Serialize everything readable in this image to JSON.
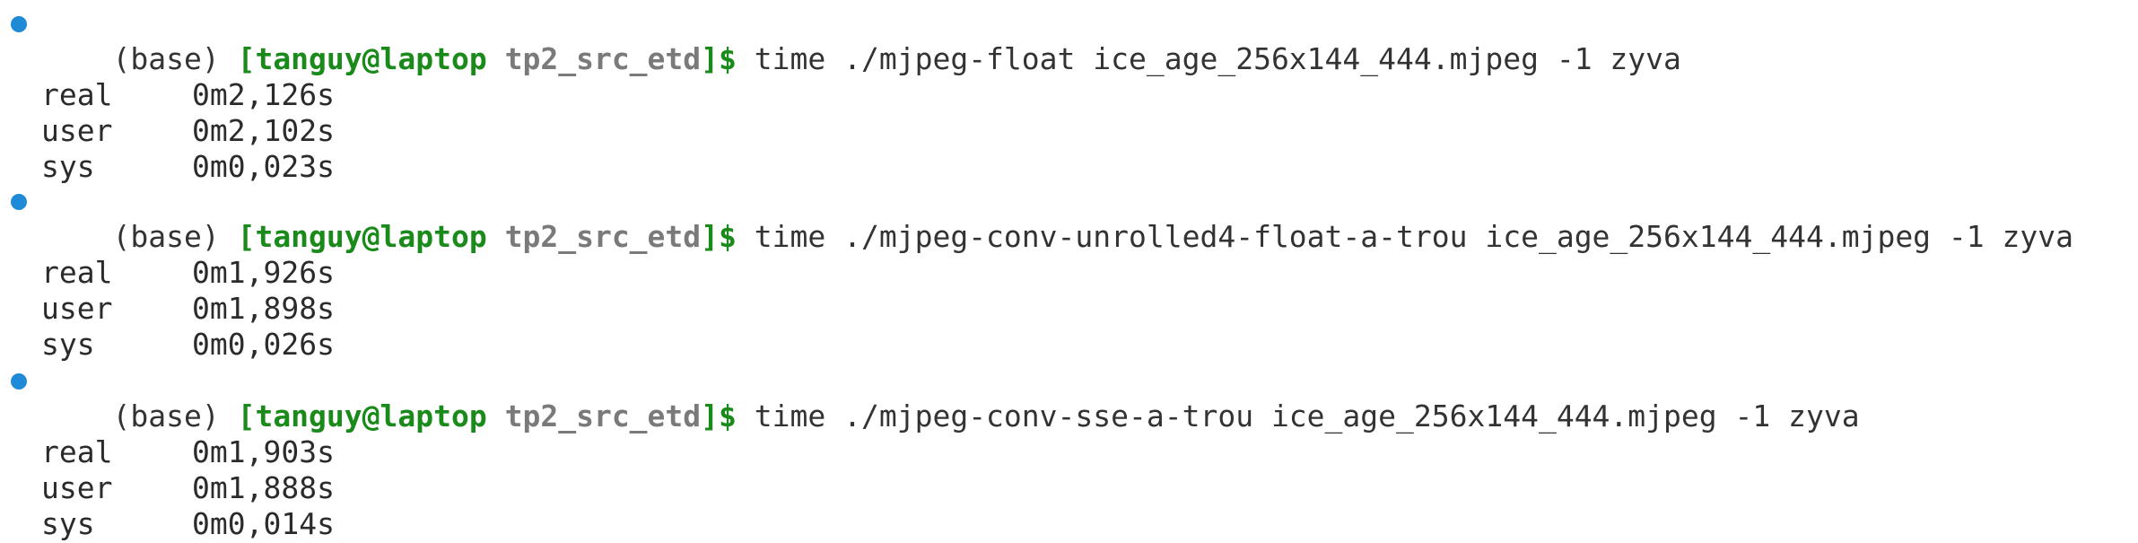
{
  "terminal": {
    "blocks": [
      {
        "env": "(base)",
        "user_host": "[tanguy@laptop",
        "cwd": "tp2_src_etd",
        "prompt_end": "]$",
        "command": "time ./mjpeg-float ice_age_256x144_444.mjpeg -1 zyva",
        "real_label": "real",
        "real_value": "0m2,126s",
        "user_label": "user",
        "user_value": "0m2,102s",
        "sys_label": "sys",
        "sys_value": "0m0,023s"
      },
      {
        "env": "(base)",
        "user_host": "[tanguy@laptop",
        "cwd": "tp2_src_etd",
        "prompt_end": "]$",
        "command": "time ./mjpeg-conv-unrolled4-float-a-trou ice_age_256x144_444.mjpeg -1 zyva",
        "real_label": "real",
        "real_value": "0m1,926s",
        "user_label": "user",
        "user_value": "0m1,898s",
        "sys_label": "sys",
        "sys_value": "0m0,026s"
      },
      {
        "env": "(base)",
        "user_host": "[tanguy@laptop",
        "cwd": "tp2_src_etd",
        "prompt_end": "]$",
        "command": "time ./mjpeg-conv-sse-a-trou ice_age_256x144_444.mjpeg -1 zyva",
        "real_label": "real",
        "real_value": "0m1,903s",
        "user_label": "user",
        "user_value": "0m1,888s",
        "sys_label": "sys",
        "sys_value": "0m0,014s"
      }
    ],
    "colors": {
      "prompt_green": "#1a8a1a",
      "cwd_gray": "#7a7a7a",
      "status_dot_blue": "#1f8ad6"
    }
  }
}
